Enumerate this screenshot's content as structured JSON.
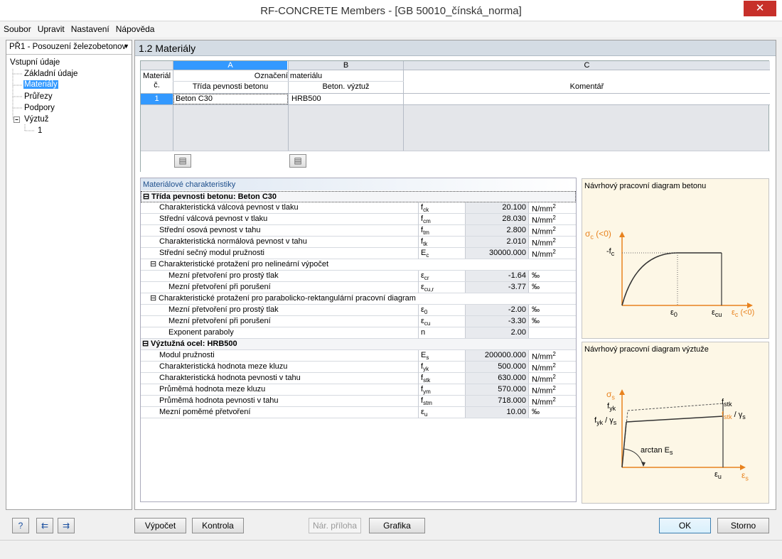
{
  "window": {
    "title": "RF-CONCRETE Members - [GB 50010_čínská_norma]",
    "close": "✕"
  },
  "menu": [
    "Soubor",
    "Upravit",
    "Nastavení",
    "Nápověda"
  ],
  "nav": {
    "case": "PŘ1 - Posouzení železobetonov",
    "root": "Vstupní údaje",
    "items": [
      "Základní údaje",
      "Materiály",
      "Průřezy",
      "Podpory",
      "Výztuž"
    ],
    "sub": "1",
    "toggle": "⊟"
  },
  "section": {
    "title": "1.2 Materiály"
  },
  "grid": {
    "col_letters": [
      "A",
      "B",
      "C"
    ],
    "rowhead": [
      "Materiál",
      "č."
    ],
    "group_header": "Označení materiálu",
    "headers": [
      "Třída pevnosti betonu",
      "Beton. výztuž",
      "Komentář"
    ],
    "rows": [
      {
        "no": "1",
        "concrete": "Beton C30",
        "rebar": "HRB500",
        "comment": ""
      }
    ]
  },
  "props": {
    "title": "Materiálové charakteristiky",
    "rows": [
      {
        "level": 0,
        "label": "Třída pevnosti betonu: Beton C30",
        "collapse": "⊟"
      },
      {
        "level": 1,
        "label": "Charakteristická válcová pevnost v tlaku",
        "sym": "f",
        "sub": "ck",
        "val": "20.100",
        "unit": "N/mm",
        "sup": "2"
      },
      {
        "level": 1,
        "label": "Střední válcová pevnost v tlaku",
        "sym": "f",
        "sub": "cm",
        "val": "28.030",
        "unit": "N/mm",
        "sup": "2"
      },
      {
        "level": 1,
        "label": "Střední osová pevnost v tahu",
        "sym": "f",
        "sub": "tm",
        "val": "2.800",
        "unit": "N/mm",
        "sup": "2"
      },
      {
        "level": 1,
        "label": "Charakteristická normálová pevnost v tahu",
        "sym": "f",
        "sub": "tk",
        "val": "2.010",
        "unit": "N/mm",
        "sup": "2"
      },
      {
        "level": 1,
        "label": "Střední sečný modul pružnosti",
        "sym": "E",
        "sub": "c",
        "val": "30000.000",
        "unit": "N/mm",
        "sup": "2"
      },
      {
        "level": 2,
        "label": "Charakteristické protažení pro nelineární výpočet",
        "collapse": "⊟"
      },
      {
        "level": 3,
        "label": "Mezní přetvoření pro prostý tlak",
        "sym": "ε",
        "sub": "cr",
        "val": "-1.64",
        "unit": "‰"
      },
      {
        "level": 3,
        "label": "Mezní přetvoření při porušení",
        "sym": "ε",
        "sub": "cu,r",
        "val": "-3.77",
        "unit": "‰"
      },
      {
        "level": 2,
        "label": "Charakteristické protažení pro parabolicko-rektangulární pracovní diagram",
        "collapse": "⊟"
      },
      {
        "level": 3,
        "label": "Mezní přetvoření pro prostý tlak",
        "sym": "ε",
        "sub": "0",
        "val": "-2.00",
        "unit": "‰"
      },
      {
        "level": 3,
        "label": "Mezní přetvoření při porušení",
        "sym": "ε",
        "sub": "cu",
        "val": "-3.30",
        "unit": "‰"
      },
      {
        "level": 3,
        "label": "Exponent paraboly",
        "sym": "n",
        "sub": "",
        "val": "2.00",
        "unit": ""
      },
      {
        "level": 0,
        "label": "Výztužná ocel: HRB500",
        "collapse": "⊟"
      },
      {
        "level": 1,
        "label": "Modul pružnosti",
        "sym": "E",
        "sub": "s",
        "val": "200000.000",
        "unit": "N/mm",
        "sup": "2"
      },
      {
        "level": 1,
        "label": "Charakteristická hodnota meze kluzu",
        "sym": "f",
        "sub": "yk",
        "val": "500.000",
        "unit": "N/mm",
        "sup": "2"
      },
      {
        "level": 1,
        "label": "Charakteristická hodnota pevnosti v tahu",
        "sym": "f",
        "sub": "stk",
        "val": "630.000",
        "unit": "N/mm",
        "sup": "2"
      },
      {
        "level": 1,
        "label": "Průměmá hodnota meze kluzu",
        "sym": "f",
        "sub": "ym",
        "val": "570.000",
        "unit": "N/mm",
        "sup": "2"
      },
      {
        "level": 1,
        "label": "Průměmá hodnota pevnosti v tahu",
        "sym": "f",
        "sub": "stm",
        "val": "718.000",
        "unit": "N/mm",
        "sup": "2"
      },
      {
        "level": 1,
        "label": "Mezní  poměmé přetvoření",
        "sym": "ε",
        "sub": "u",
        "val": "10.00",
        "unit": "‰"
      }
    ]
  },
  "diagram1": {
    "title": "Návrhový pracovní diagram betonu",
    "ylabel": "σ",
    "ysub": "c",
    "ysuffix": " (<0)",
    "fc": "-f",
    "fcsub": "c",
    "e0": "ε",
    "e0sub": "0",
    "ecu": "ε",
    "ecusub": "cu",
    "xlabel": "ε",
    "xsub": "c",
    "xsuffix": " (<0)"
  },
  "diagram2": {
    "title": "Návrhový pracovní diagram výztuže",
    "ylabel": "σ",
    "ysub": "s",
    "fyk": "f",
    "fyksub": "yk",
    "fykg": "f",
    "fykgsub": "yk",
    "fykgmid": " / γ",
    "fykgsub2": "s",
    "fstk": "f",
    "fstksub": "stk",
    "fstkg": "f",
    "fstkgsub": "stk",
    "fstkgmid": " / γ",
    "fstkgsub2": "s",
    "arctan": "arctan E",
    "arctansub": "s",
    "eu": "ε",
    "eusub": "u",
    "xlabel": "ε",
    "xsub": "s"
  },
  "buttons": {
    "calc": "Výpočet",
    "check": "Kontrola",
    "annex": "Nár. příloha ...",
    "graphics": "Grafika",
    "ok": "OK",
    "cancel": "Storno",
    "help_icon": "?",
    "import_icon": "⇇",
    "export_icon": "⇉",
    "book_icon": "▤"
  },
  "colors": {
    "accent": "#e8821e",
    "selection": "#3399ff",
    "close": "#c7302a"
  }
}
